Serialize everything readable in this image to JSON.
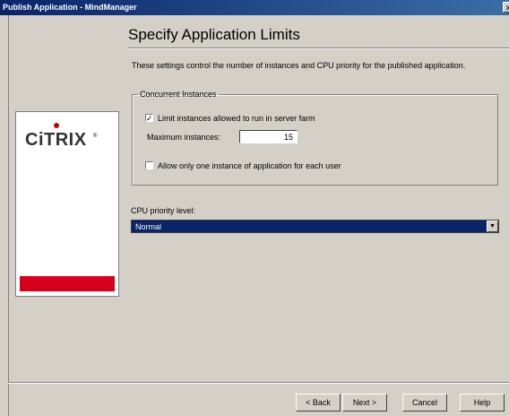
{
  "window": {
    "title": "Publish Application - MindManager",
    "close_glyph": "✕"
  },
  "page": {
    "heading": "Specify Application Limits",
    "description": "These settings control the number of instances and CPU priority for the published application."
  },
  "logo": {
    "text": "CiTRIX",
    "trademark": "®",
    "bar_color": "#d9001b"
  },
  "concurrent_instances": {
    "legend": "Concurrent Instances",
    "limit_checkbox": {
      "label": "Limit instances allowed to run in server farm",
      "checked": true,
      "mark": "✓"
    },
    "max_instances": {
      "label": "Maximum instances:",
      "value": "15"
    },
    "one_per_user_checkbox": {
      "label": "Allow only one instance of application for each user",
      "checked": false
    }
  },
  "cpu_priority": {
    "label": "CPU priority level:",
    "selected": "Normal",
    "arrow": "▼"
  },
  "buttons": {
    "back": "< Back",
    "next": "Next >",
    "cancel": "Cancel",
    "help": "Help"
  }
}
